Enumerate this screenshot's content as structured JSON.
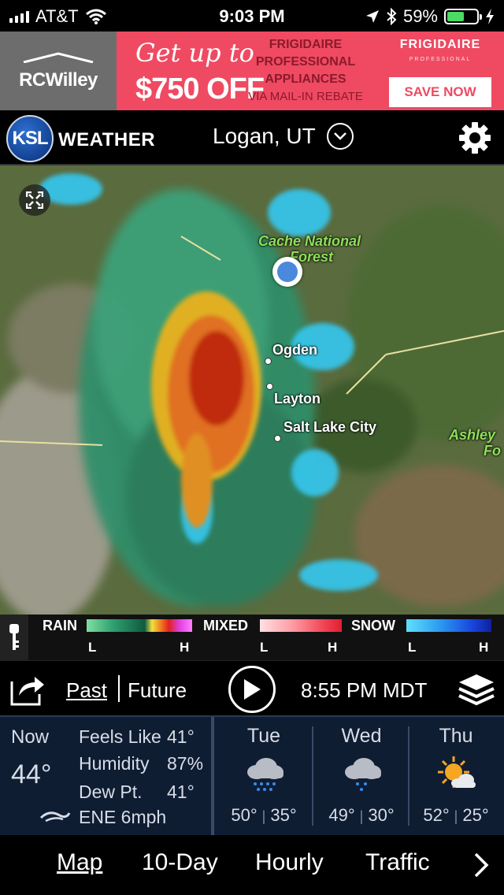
{
  "status_bar": {
    "carrier": "AT&T",
    "time": "9:03 PM",
    "battery": "59%",
    "battery_level": 0.59,
    "icons": [
      "signal-icon",
      "wifi-icon",
      "location-arrow-icon",
      "bluetooth-icon",
      "battery-icon",
      "charging-icon"
    ]
  },
  "ad": {
    "brand": "RCWilley",
    "offer_line1": "Get up to",
    "offer_line2": "$750 OFF",
    "product_line1": "FRIGIDAIRE",
    "product_line2": "PROFESSIONAL",
    "product_line3": "APPLIANCES",
    "rebate": "VIA MAIL-IN REBATE",
    "logo_text": "FRIGIDAIRE",
    "logo_sub": "PROFESSIONAL",
    "cta": "SAVE NOW",
    "colors": {
      "banner": "#ef4a62",
      "brand_block": "#6d6d6d"
    }
  },
  "header": {
    "logo": "KSL",
    "logo_word": "WEATHER",
    "location": "Logan, UT"
  },
  "map": {
    "labels": {
      "cache_forest_1": "Cache National",
      "cache_forest_2": "Forest",
      "ogden": "Ogden",
      "layton": "Layton",
      "slc": "Salt Lake City",
      "ashley_1": "Ashley",
      "ashley_2": "Fo"
    }
  },
  "legend": {
    "rain": "RAIN",
    "mixed": "MIXED",
    "snow": "SNOW",
    "low": "L",
    "high": "H"
  },
  "controls": {
    "past": "Past",
    "future": "Future",
    "time": "8:55 PM MDT"
  },
  "current": {
    "label": "Now",
    "temp": "44°",
    "feels_like_label": "Feels Like",
    "feels_like": "41°",
    "humidity_label": "Humidity",
    "humidity": "87%",
    "dew_label": "Dew Pt.",
    "dew": "41°",
    "wind": "ENE 6mph"
  },
  "forecast": [
    {
      "day": "Tue",
      "high": "50°",
      "low": "35°",
      "icon": "rain-cloud-icon"
    },
    {
      "day": "Wed",
      "high": "49°",
      "low": "30°",
      "icon": "rain-cloud-icon"
    },
    {
      "day": "Thu",
      "high": "52°",
      "low": "25°",
      "icon": "partly-sunny-icon"
    }
  ],
  "nav": {
    "items": [
      "Map",
      "10-Day",
      "Hourly",
      "Traffic"
    ],
    "active": "Map"
  }
}
